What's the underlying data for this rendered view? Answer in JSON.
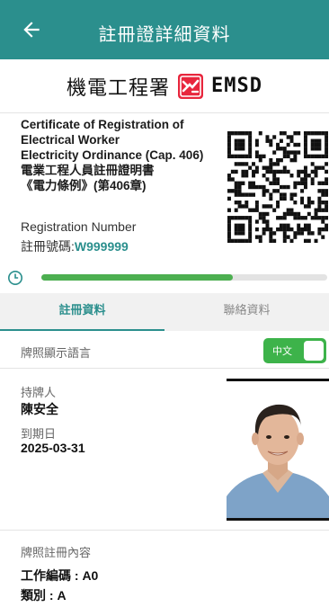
{
  "header": {
    "title": "註冊證詳細資料"
  },
  "logo": {
    "department": "機電工程署",
    "abbr": "EMSD",
    "brand_color": "#e8263d"
  },
  "certificate": {
    "lines": [
      "Certificate of Registration of",
      "Electrical Worker",
      "Electricity Ordinance (Cap. 406)",
      "電業工程人員註冊證明書",
      "《電力條例》(第406章)"
    ],
    "reg_label_en": "Registration Number",
    "reg_label_cn": "註冊號碼:",
    "reg_number": "W999999"
  },
  "validity": {
    "progress_fraction": 0.67,
    "color": "#4caf50"
  },
  "tabs": [
    {
      "label": "註冊資料",
      "active": true
    },
    {
      "label": "聯絡資料",
      "active": false
    }
  ],
  "language": {
    "label": "牌照顯示語言",
    "toggle_label": "中文",
    "on": true
  },
  "holder": {
    "name_label": "持牌人",
    "name": "陳安全",
    "expiry_label": "到期日",
    "expiry": "2025-03-31"
  },
  "registration": {
    "label": "牌照註冊內容",
    "work_code": "工作編碼 : A0",
    "category": "類別 : A"
  },
  "theme": {
    "accent": "#2b8f8d"
  }
}
